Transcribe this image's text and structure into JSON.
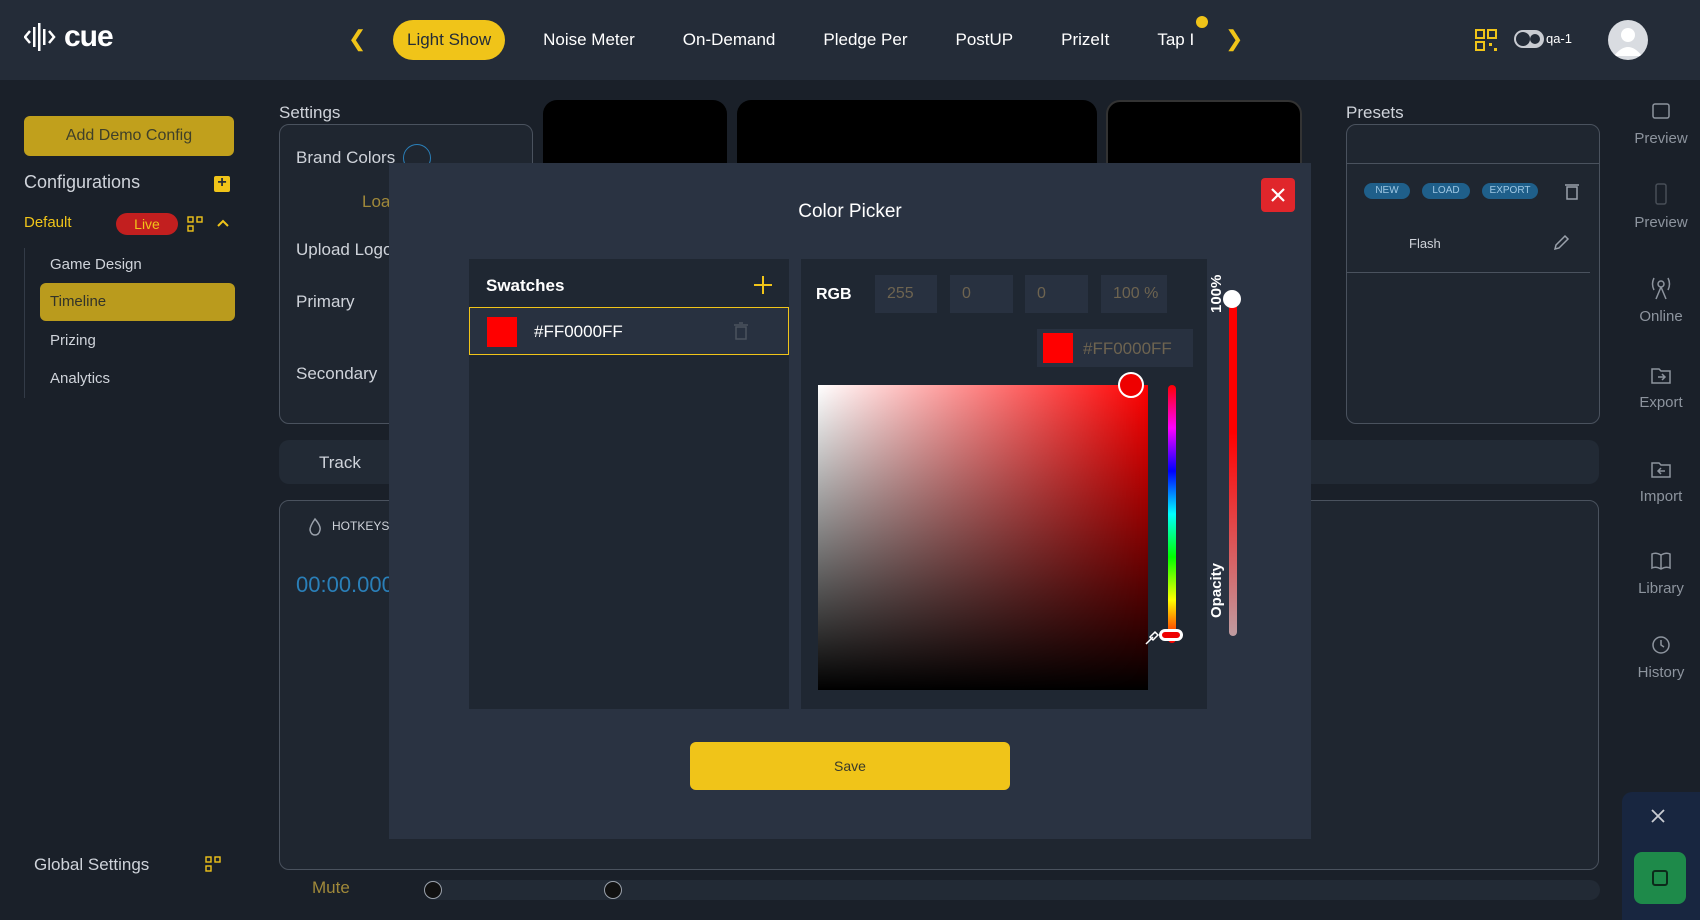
{
  "app": {
    "logo_text": "cue",
    "user": "qa-1"
  },
  "nav": {
    "tabs": [
      "Light Show",
      "Noise Meter",
      "On-Demand",
      "Pledge Per",
      "PostUP",
      "PrizeIt",
      "Tap I"
    ],
    "active": "Light Show"
  },
  "sidebar": {
    "add_demo": "Add Demo Config",
    "configurations": "Configurations",
    "default": "Default",
    "live": "Live",
    "items": [
      "Game Design",
      "Timeline",
      "Prizing",
      "Analytics"
    ],
    "global_settings": "Global Settings"
  },
  "background": {
    "settings": "Settings",
    "brand_colors": "Brand Colors",
    "loading": "Loa",
    "upload_logo": "Upload Logo",
    "primary": "Primary",
    "secondary": "Secondary",
    "track": "Track",
    "hotkeys": "HOTKEYS",
    "time": "00:00.000",
    "mute": "Mute",
    "presets": "Presets",
    "preset_buttons": [
      "NEW",
      "LOAD",
      "EXPORT"
    ],
    "preset_item": "Flash"
  },
  "rail": {
    "items": [
      "Preview",
      "Preview",
      "Online",
      "Export",
      "Import",
      "Library",
      "History"
    ]
  },
  "modal": {
    "title": "Color Picker",
    "swatches_title": "Swatches",
    "swatch_hex": "#FF0000FF",
    "rgb_label": "RGB",
    "r": "255",
    "g": "0",
    "b": "0",
    "alpha": "100 %",
    "hex": "#FF0000FF",
    "opacity_value": "100%",
    "opacity_label": "Opacity",
    "save": "Save",
    "selected_color": "#FF0000",
    "hue_position": 1.0,
    "opacity_fraction": 1.0
  },
  "colors": {
    "accent": "#f0c419",
    "danger": "#e0262b",
    "bg": "#1a2029",
    "bar": "#242c38"
  }
}
